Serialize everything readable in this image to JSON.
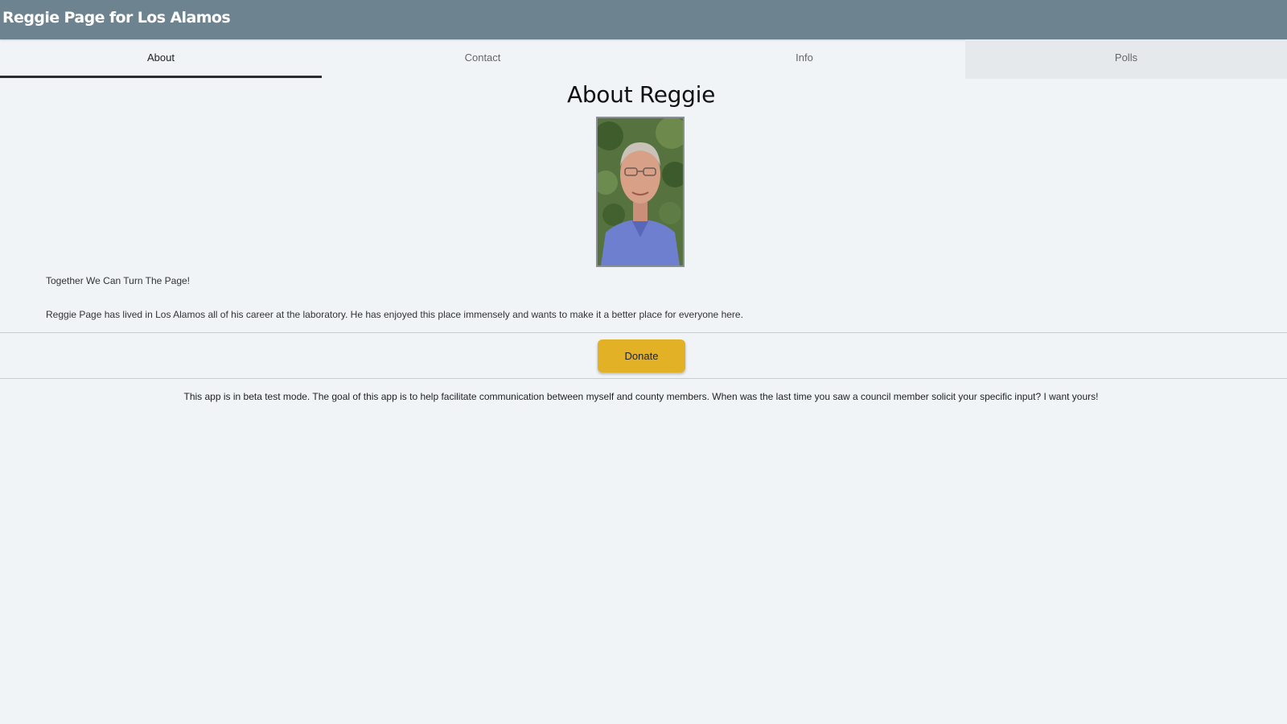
{
  "appbar": {
    "title": "Reggie Page for Los Alamos"
  },
  "tabs": [
    {
      "label": "About",
      "active": true
    },
    {
      "label": "Contact",
      "active": false
    },
    {
      "label": "Info",
      "active": false
    },
    {
      "label": "Polls",
      "active": false
    }
  ],
  "about": {
    "heading": "About Reggie",
    "tagline": "Together We Can Turn The Page!",
    "bio": "Reggie Page has lived in Los Alamos all of his career at the laboratory.  He has enjoyed this place immensely and wants to make it a better place for everyone here."
  },
  "donate": {
    "label": "Donate",
    "color": "#e3b125"
  },
  "footer": {
    "note": "This app is in beta test mode.  The goal of this app is to help facilitate communication between myself and county members.  When was the last time you saw a council member solicit your specific input?  I want yours!"
  },
  "colors": {
    "appbar": "#6e8390",
    "background": "#f0f4f7",
    "active_tab_indicator": "#2b2b2b"
  }
}
